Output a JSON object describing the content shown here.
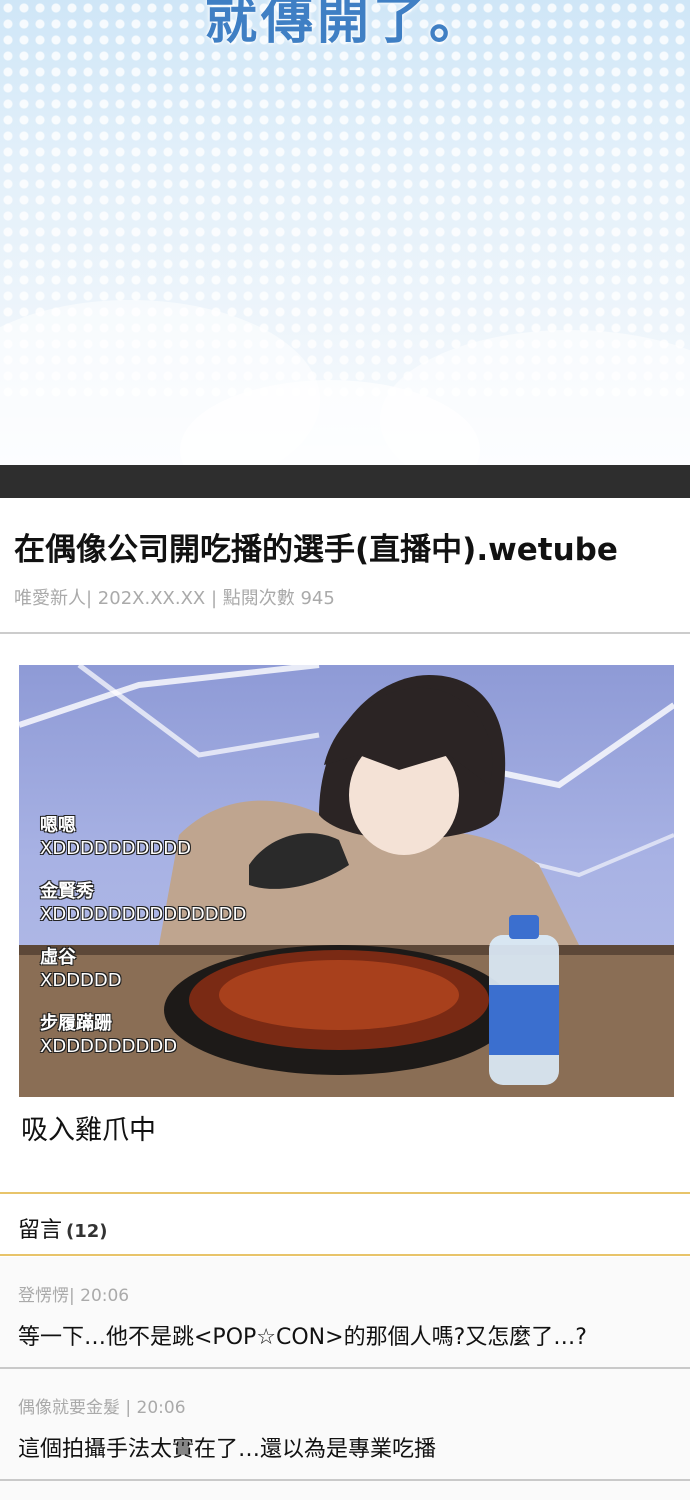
{
  "banner": {
    "text": "就傳開了。"
  },
  "post": {
    "title": "在偶像公司開吃播的選手(直播中).wetube",
    "meta": "唯愛新人| 202X.XX.XX | 點閱次數 945"
  },
  "image": {
    "overlay_comments": [
      {
        "name": "嗯嗯",
        "text": "XDDDDDDDDDD"
      },
      {
        "name": "金賢秀",
        "text": "XDDDDDDDDDDDDDD"
      },
      {
        "name": "虛谷",
        "text": "XDDDDD"
      },
      {
        "name": "步履蹣跚",
        "text": "XDDDDDDDDD"
      }
    ]
  },
  "caption": "吸入雞爪中",
  "comments": {
    "label": "留言",
    "count": "(12)",
    "items": [
      {
        "meta": "登愣愣| 20:06",
        "text": "等一下…他不是跳<POP☆CON>的那個人嗎?又怎麼了…?"
      },
      {
        "meta": "偶像就要金髮 | 20:06",
        "text": "這個拍攝手法太實在了…還以為是專業吃播"
      }
    ]
  }
}
